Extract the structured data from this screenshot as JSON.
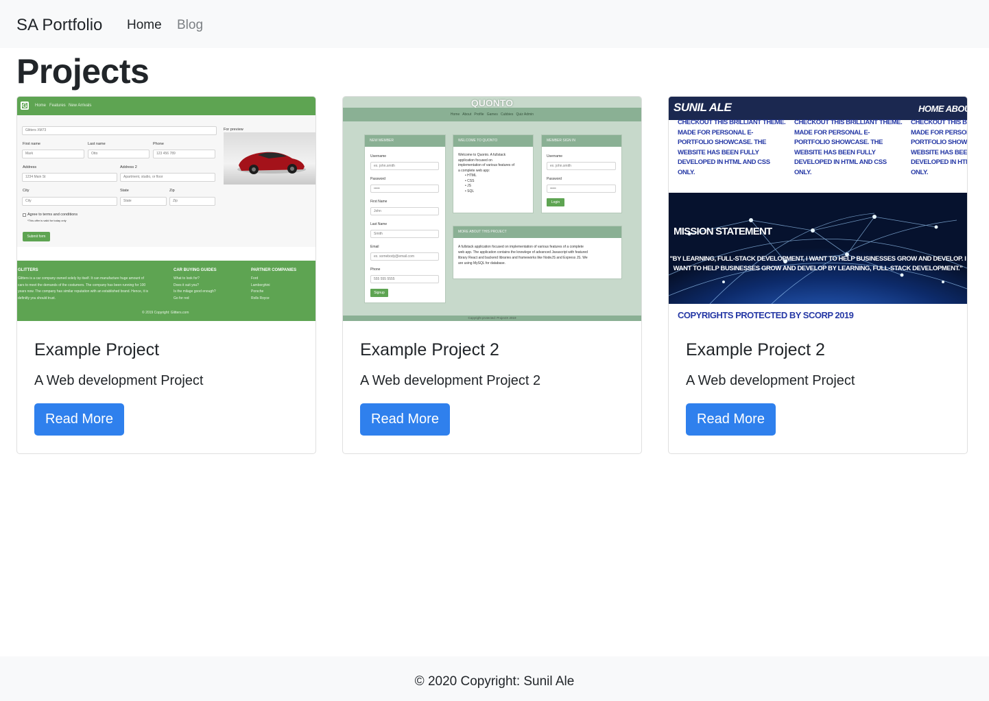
{
  "navbar": {
    "brand": "SA Portfolio",
    "links": [
      {
        "label": "Home",
        "active": true
      },
      {
        "label": "Blog",
        "active": false
      }
    ]
  },
  "page": {
    "title": "Projects"
  },
  "projects": [
    {
      "title": "Example Project",
      "description": "A Web development Project",
      "button": "Read More",
      "thumbnail": {
        "nav": [
          "Home",
          "Features",
          "New Arrivals"
        ],
        "select_value": "Glitters XM73",
        "preview_label": "For preview",
        "fields": [
          {
            "label": "First name",
            "value": "Mark"
          },
          {
            "label": "Last name",
            "value": "Otto"
          },
          {
            "label": "Phone",
            "value": "123 456 789"
          },
          {
            "label": "Address",
            "value": "1234 Main St"
          },
          {
            "label": "Address 2",
            "value": "Apartment, studio, or floor"
          },
          {
            "label": "City",
            "value": "City"
          },
          {
            "label": "State",
            "value": "State"
          },
          {
            "label": "Zip",
            "value": "Zip"
          }
        ],
        "checkbox_label": "Agree to terms and conditions",
        "checkbox_note": "*This offer is valid for today only",
        "submit": "Submit form",
        "footer_cols": [
          {
            "heading": "GLITTERS",
            "lines": [
              "Glitters is a car company owned solely by itself. It can manufacture huge amount of",
              "cars to meet the demands of the costumers. The company has been running for 100",
              "years now. The company has similar reputation with an established brand. Hence, it is",
              "definitly you should trust."
            ]
          },
          {
            "heading": "CAR BUYING GUIDES",
            "lines": [
              "What to look for?",
              "Does it suit you?",
              "Is the milage good enough?",
              "Go for red"
            ]
          },
          {
            "heading": "PARTNER COMPANIES",
            "lines": [
              "Ford",
              "Lamborghini",
              "Porsche",
              "Rolls Royce"
            ]
          }
        ],
        "copyright": "© 2019 Copyright: Glitters.com"
      }
    },
    {
      "title": "Example Project 2",
      "description": "A Web development Project 2",
      "button": "Read More",
      "thumbnail": {
        "title": "QUONTO",
        "nav": "Home   About   Profile   Games   Cubbies   Quiz Admin",
        "new_member": {
          "heading": "NEW MEMBER",
          "fields": [
            {
              "label": "Username",
              "value": "ex. john.smith"
            },
            {
              "label": "Password",
              "value": "•••••"
            },
            {
              "label": "First Name",
              "value": "John"
            },
            {
              "label": "Last Name",
              "value": "Smith"
            },
            {
              "label": "Email",
              "value": "ex. somebody@email.com"
            },
            {
              "label": "Phone",
              "value": "555 555 5555"
            }
          ],
          "button": "Signup"
        },
        "welcome": {
          "heading": "WELCOME TO QUONTO",
          "lines": [
            "Welcome to Quonto. A fullstack",
            "application focused on",
            "implementation of various features of",
            "a complete web app:"
          ],
          "bullets": [
            "HTML",
            "CSS",
            "JS",
            "SQL"
          ]
        },
        "sign_in": {
          "heading": "MEMBER SIGN IN",
          "fields": [
            {
              "label": "Username",
              "value": "ex. john.smith"
            },
            {
              "label": "Password",
              "value": "•••••"
            }
          ],
          "button": "Login"
        },
        "about": {
          "heading": "MORE ABOUT THIS PROJECT",
          "lines": [
            "A fullstack application focused on implementation of various features of a complete",
            "web app. The application contains the knowlege of advanced Javascript with featured",
            "library React and backend libraries and frameworks like NodeJS and Express JS. We",
            "are using MySQL for database."
          ]
        },
        "footer": "Copyright protected: ProjectX 2019"
      }
    },
    {
      "title": "Example Project 2",
      "description": "A Web development Project",
      "button": "Read More",
      "thumbnail": {
        "brand": "SUNIL ALE",
        "menu": "HOME   ABOUT",
        "blurb": "CHECKOUT THIS BRILLIANT THEME. MADE FOR PERSONAL E-PORTFOLIO SHOWCASE. THE WEBSITE HAS BEEN FULLY DEVELOPED IN HTML AND CSS ONLY.",
        "mission": "MISSION STATEMENT",
        "quote": "\"BY LEARNING, FULL-STACK DEVELOPMENT, I WANT TO HELP BUSINESSES GROW AND DEVELOP. I WANT TO HELP BUSINESSES GROW AND DEVELOP BY LEARNING, FULL-STACK DEVELOPMENT.\"",
        "copyright": "COPYRIGHTS PROTECTED BY SCORP 2019"
      }
    }
  ],
  "footer": {
    "text": "© 2020 Copyright: Sunil Ale"
  },
  "colors": {
    "navbar_bg": "#f8f9fa",
    "primary_button": "#2f80ed",
    "thumb1_green": "#5ea452",
    "thumb2_green": "#8ab094",
    "thumb3_navy": "#1b2850"
  }
}
